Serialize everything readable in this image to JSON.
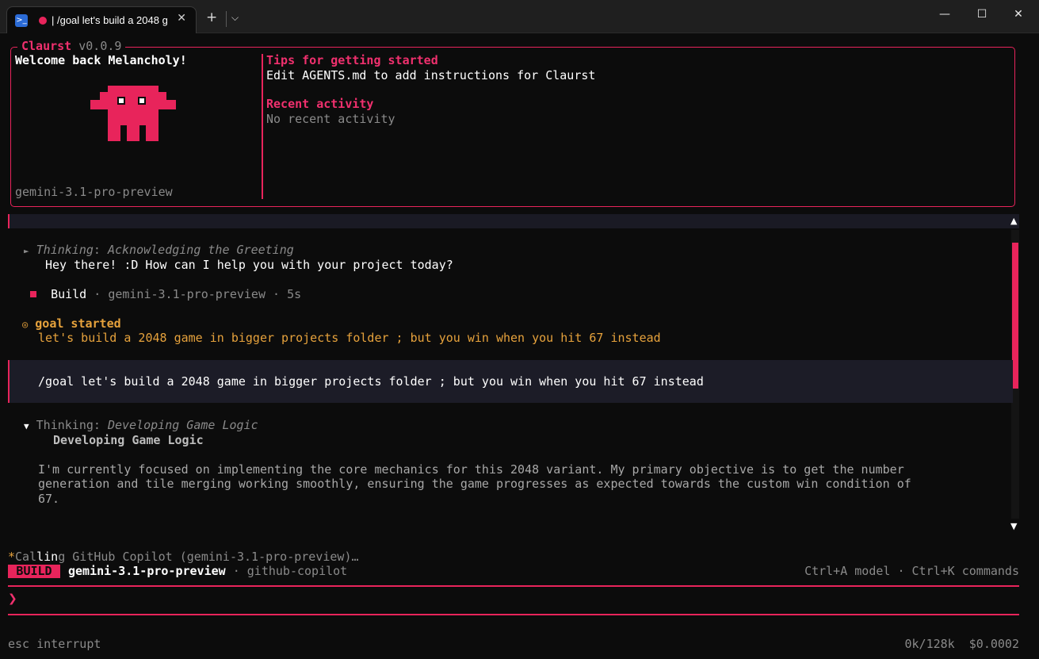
{
  "window": {
    "tab_title": "| /goal let's build a 2048 g",
    "new_tab_glyph": "+",
    "dropdown_glyph": "⌵",
    "minimize_glyph": "—",
    "maximize_glyph": "☐",
    "close_glyph": "✕",
    "tab_close_glyph": "✕"
  },
  "header": {
    "app_name": "Claurst",
    "version": "v0.0.9",
    "welcome": "Welcome back Melancholy!",
    "model": "gemini-3.1-pro-preview",
    "tips_title": "Tips for getting started",
    "tips_text": "Edit AGENTS.md to add instructions for Claurst",
    "recent_title": "Recent activity",
    "recent_text": "No recent activity"
  },
  "chat": {
    "thinking1": {
      "arrow": "►",
      "label": "Thinking",
      "colon": ":",
      "topic": " Acknowledging the Greeting"
    },
    "reply1": "Hey there! :D How can I help you with your project today?",
    "build_line": {
      "label": "Build",
      "sep1": " · ",
      "model": "gemini-3.1-pro-preview",
      "sep2": " · ",
      "duration": "5s"
    },
    "goal": {
      "icon": "◎",
      "title": "goal started",
      "text": "let's build a 2048 game in bigger projects folder ; but you win when you hit 67 instead"
    },
    "user_message": "/goal let's build a 2048 game in bigger projects folder ; but you win when you hit 67 instead",
    "thinking2": {
      "arrow": "▼",
      "label": "Thinking",
      "colon": ":",
      "topic": " Developing Game Logic",
      "heading": "Developing Game Logic",
      "body_line1": "I'm currently focused on implementing the core mechanics for this 2048 variant. My primary objective is to get the number",
      "body_line2": "generation and tile merging working smoothly, ensuring the game progresses as expected towards the custom win condition of",
      "body_line3": "67."
    },
    "scroll_up_glyph": "▲",
    "scroll_down_glyph": "▼"
  },
  "status": {
    "spinner": "*",
    "calling_a": "Cal",
    "calling_b": "lin",
    "calling_c": "g GitHub Copilot (gemini-3.1-pro-preview)…",
    "mode_badge": "BUILD",
    "model": "gemini-3.1-pro-preview",
    "provider_sep": " · ",
    "provider": "github-copilot",
    "shortcuts": "Ctrl+A model · Ctrl+K commands"
  },
  "input": {
    "prompt_glyph": "❯",
    "value": ""
  },
  "footer": {
    "hint": "esc interrupt",
    "tokens": "0k/128k",
    "cost": "$0.0002"
  },
  "colors": {
    "accent": "#e8245b",
    "amber": "#e6a23c",
    "background": "#0c0c0c"
  }
}
